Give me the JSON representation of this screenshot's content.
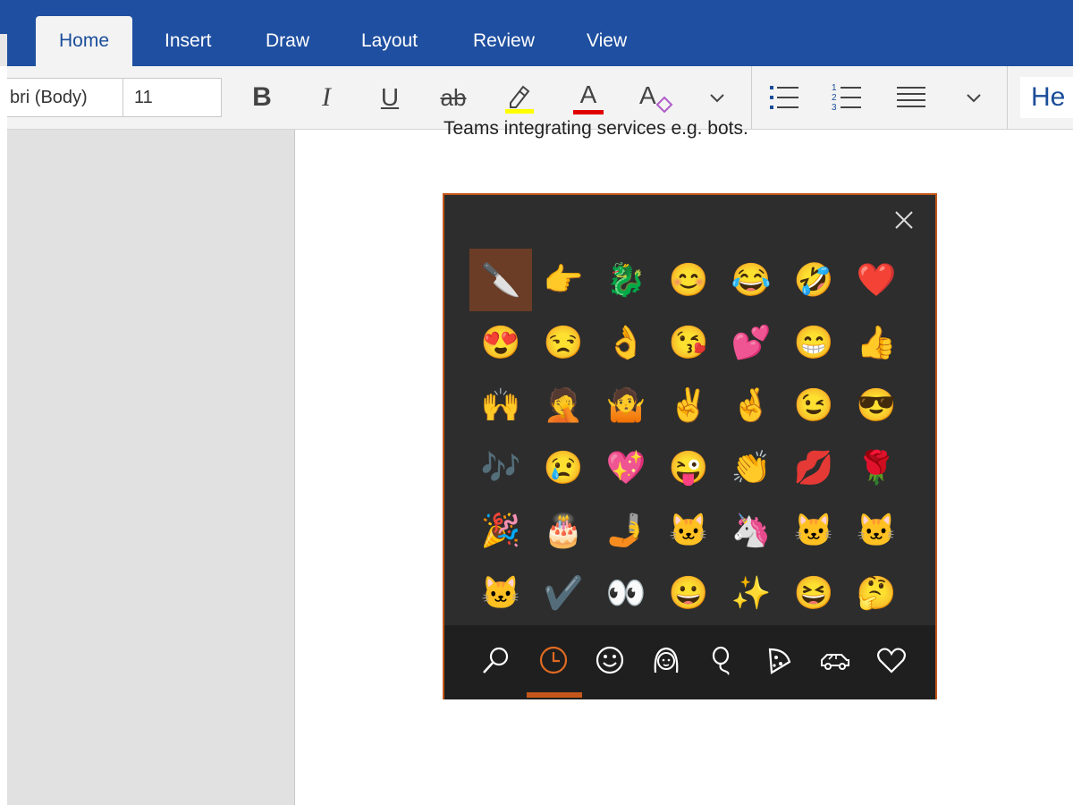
{
  "ribbon": {
    "tabs": [
      {
        "label": "Home",
        "active": true
      },
      {
        "label": "Insert"
      },
      {
        "label": "Draw"
      },
      {
        "label": "Layout"
      },
      {
        "label": "Review"
      },
      {
        "label": "View"
      }
    ],
    "accent_color": "#1f4fa0"
  },
  "toolbar": {
    "font_name": "bri (Body)",
    "font_size": "11",
    "bold_label": "B",
    "italic_label": "I",
    "underline_label": "U",
    "strike_label": "ab",
    "font_color_label": "A",
    "clear_format_label": "A",
    "style_preview": "He",
    "highlight_color": "#ffff00",
    "font_color": "#e00000"
  },
  "document": {
    "partial_line": "Teams integrating services e.g. bots."
  },
  "emoji_panel": {
    "border_color": "#c5561a",
    "selected_index": 0,
    "emojis": [
      "🔪",
      "👉",
      "🐉",
      "😊",
      "😂",
      "🤣",
      "❤️",
      "😍",
      "😒",
      "👌",
      "😘",
      "💕",
      "😁",
      "👍",
      "🙌",
      "🤦",
      "🤷",
      "✌️",
      "🤞",
      "😉",
      "😎",
      "🎶",
      "😢",
      "💖",
      "😜",
      "👏",
      "💋",
      "🌹",
      "🎉",
      "🎂",
      "🤳",
      "🐱",
      "🦄",
      "🐱",
      "🐱",
      "🐱",
      "✔️",
      "👀",
      "😀",
      "✨",
      "😆",
      "🤔"
    ],
    "categories": [
      {
        "name": "search-icon"
      },
      {
        "name": "recent-clock-icon",
        "active": true
      },
      {
        "name": "smiley-icon"
      },
      {
        "name": "people-icon"
      },
      {
        "name": "balloon-icon"
      },
      {
        "name": "pizza-icon"
      },
      {
        "name": "car-icon"
      },
      {
        "name": "heart-icon"
      }
    ]
  }
}
